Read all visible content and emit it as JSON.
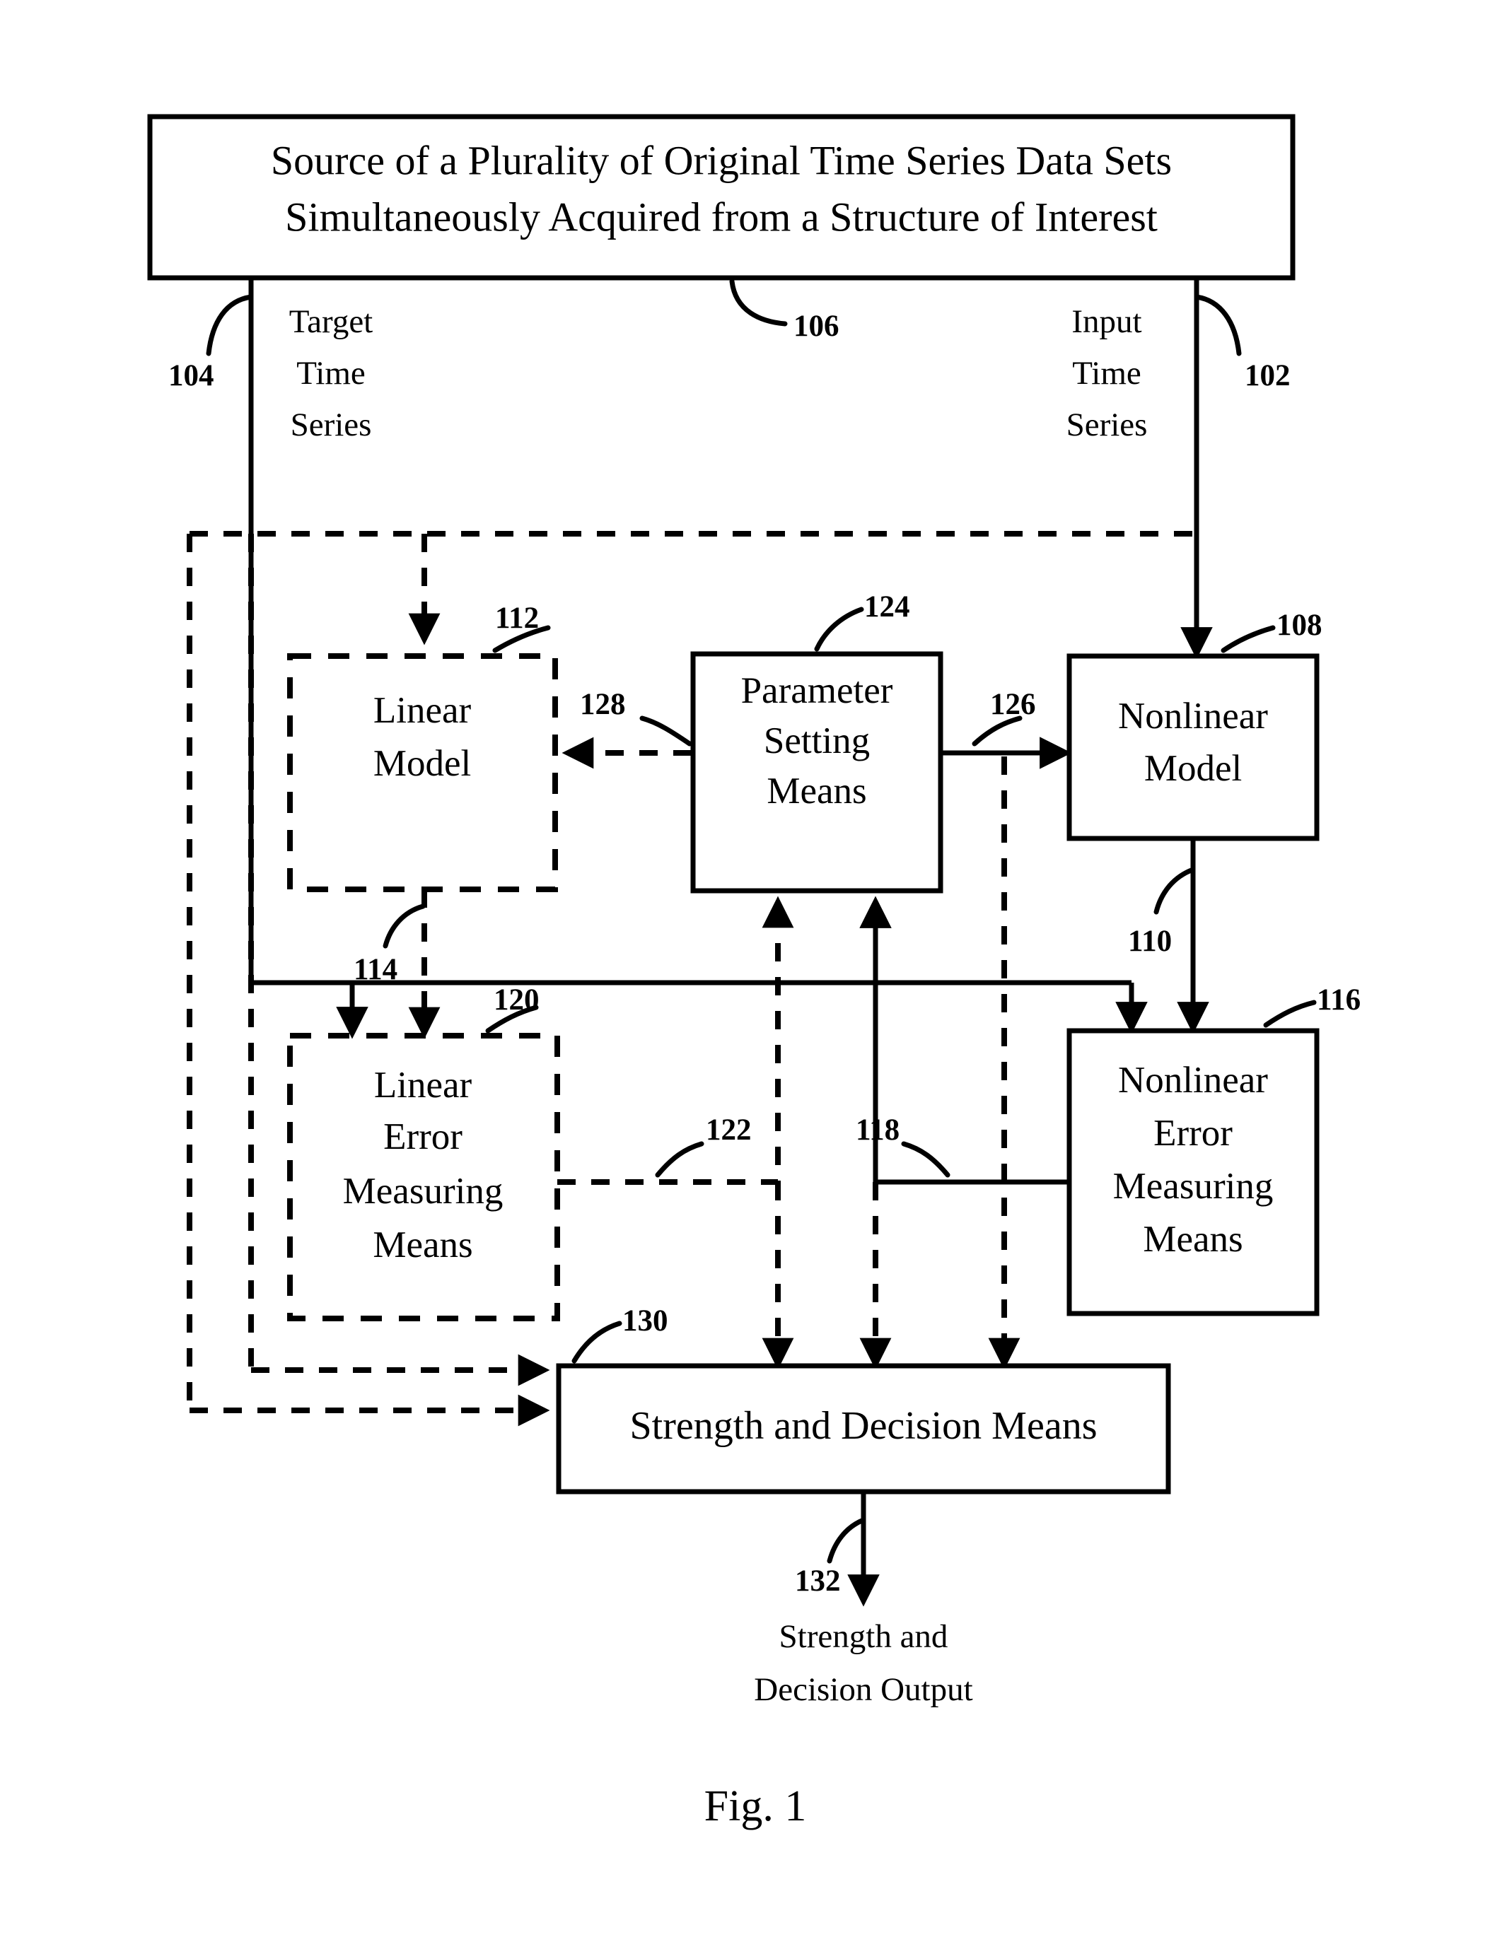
{
  "figure": {
    "caption": "Fig. 1",
    "source_box": {
      "line1": "Source of a Plurality of Original Time Series Data Sets",
      "line2": "Simultaneously Acquired from a Structure of Interest",
      "ref": "106"
    },
    "flows": {
      "target_time_series": {
        "line1": "Target",
        "line2": "Time",
        "line3": "Series",
        "ref": "104"
      },
      "input_time_series": {
        "line1": "Input",
        "line2": "Time",
        "line3": "Series",
        "ref": "102"
      },
      "output": {
        "line1": "Strength and",
        "line2": "Decision Output",
        "ref": "132"
      }
    },
    "blocks": {
      "linear_model": {
        "line1": "Linear",
        "line2": "Model",
        "ref": "112",
        "style": "dashed"
      },
      "parameter_setting_means": {
        "line1": "Parameter",
        "line2": "Setting",
        "line3": "Means",
        "ref": "124",
        "style": "solid"
      },
      "nonlinear_model": {
        "line1": "Nonlinear",
        "line2": "Model",
        "ref": "108",
        "style": "solid"
      },
      "linear_error_measuring_means": {
        "line1": "Linear",
        "line2": "Error",
        "line3": "Measuring",
        "line4": "Means",
        "ref": "120",
        "style": "dashed"
      },
      "nonlinear_error_measuring_means": {
        "line1": "Nonlinear",
        "line2": "Error",
        "line3": "Measuring",
        "line4": "Means",
        "ref": "116",
        "style": "solid"
      },
      "strength_and_decision_means": {
        "line1": "Strength and Decision Means",
        "ref": "130",
        "style": "solid"
      }
    },
    "connector_refs": {
      "linear_model_output": "114",
      "nonlinear_model_output": "110",
      "nonlinear_error_output": "118",
      "linear_error_output": "122",
      "param_to_nonlinear": "126",
      "param_to_linear": "128"
    }
  }
}
